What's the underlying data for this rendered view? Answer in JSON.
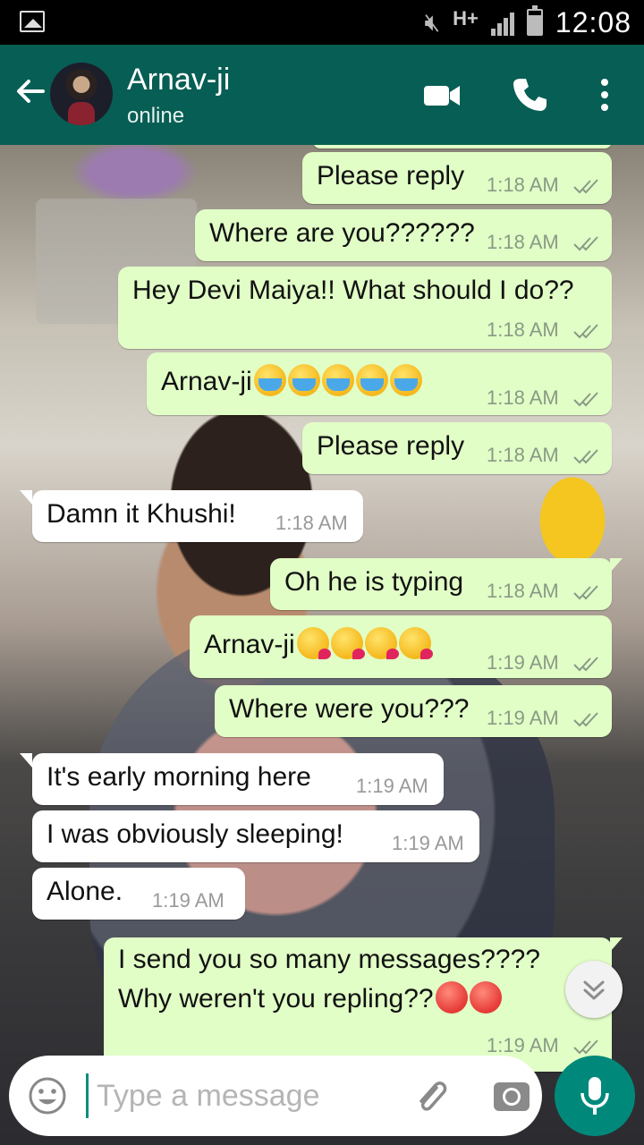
{
  "status_bar": {
    "time": "12:08",
    "network": "H+"
  },
  "header": {
    "name": "Arnav-ji",
    "status": "online"
  },
  "messages": [
    {
      "dir": "out",
      "text": "Please reply",
      "time": "1:18 AM"
    },
    {
      "dir": "out",
      "text": "Where are you??????",
      "time": "1:18 AM"
    },
    {
      "dir": "out",
      "text": "Hey Devi Maiya!! What should I do??",
      "time": "1:18 AM"
    },
    {
      "dir": "out",
      "text": "Arnav-ji",
      "emoji": "loudly-crying-face x5",
      "time": "1:18 AM"
    },
    {
      "dir": "out",
      "text": "Please reply",
      "time": "1:18 AM"
    },
    {
      "dir": "in",
      "text": "Damn it Khushi!",
      "time": "1:18 AM"
    },
    {
      "dir": "out",
      "text": "Oh he is typing",
      "time": "1:18 AM"
    },
    {
      "dir": "out",
      "text": "Arnav-ji",
      "emoji": "face-blowing-a-kiss x4",
      "time": "1:19 AM"
    },
    {
      "dir": "out",
      "text": "Where were you???",
      "time": "1:19 AM"
    },
    {
      "dir": "in",
      "text": "It's early morning here",
      "time": "1:19 AM"
    },
    {
      "dir": "in",
      "text": "I was obviously sleeping!",
      "time": "1:19 AM"
    },
    {
      "dir": "in",
      "text": "Alone.",
      "time": "1:19 AM"
    },
    {
      "dir": "out",
      "text": "I send you so many messages????",
      "text2": "Why weren't you repling??",
      "emoji": "pouting-face x2",
      "time": "1:19 AM"
    }
  ],
  "input": {
    "placeholder": "Type a message"
  },
  "colors": {
    "header": "#075e54",
    "outgoing_bubble": "#e1fec6",
    "incoming_bubble": "#ffffff",
    "mic_button": "#00897b"
  }
}
